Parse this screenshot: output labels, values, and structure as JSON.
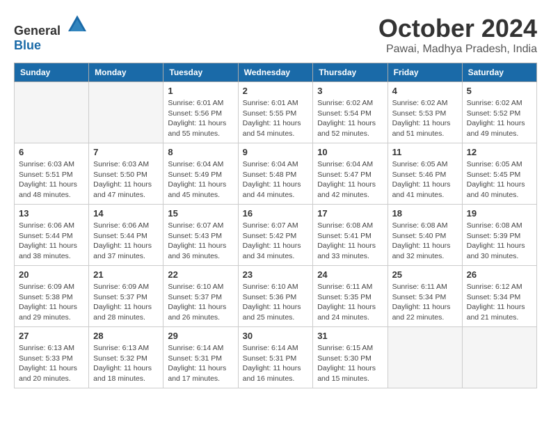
{
  "header": {
    "logo_general": "General",
    "logo_blue": "Blue",
    "month_title": "October 2024",
    "location": "Pawai, Madhya Pradesh, India"
  },
  "weekdays": [
    "Sunday",
    "Monday",
    "Tuesday",
    "Wednesday",
    "Thursday",
    "Friday",
    "Saturday"
  ],
  "weeks": [
    [
      {
        "day": null,
        "info": null
      },
      {
        "day": null,
        "info": null
      },
      {
        "day": "1",
        "info": "Sunrise: 6:01 AM\nSunset: 5:56 PM\nDaylight: 11 hours and 55 minutes."
      },
      {
        "day": "2",
        "info": "Sunrise: 6:01 AM\nSunset: 5:55 PM\nDaylight: 11 hours and 54 minutes."
      },
      {
        "day": "3",
        "info": "Sunrise: 6:02 AM\nSunset: 5:54 PM\nDaylight: 11 hours and 52 minutes."
      },
      {
        "day": "4",
        "info": "Sunrise: 6:02 AM\nSunset: 5:53 PM\nDaylight: 11 hours and 51 minutes."
      },
      {
        "day": "5",
        "info": "Sunrise: 6:02 AM\nSunset: 5:52 PM\nDaylight: 11 hours and 49 minutes."
      }
    ],
    [
      {
        "day": "6",
        "info": "Sunrise: 6:03 AM\nSunset: 5:51 PM\nDaylight: 11 hours and 48 minutes."
      },
      {
        "day": "7",
        "info": "Sunrise: 6:03 AM\nSunset: 5:50 PM\nDaylight: 11 hours and 47 minutes."
      },
      {
        "day": "8",
        "info": "Sunrise: 6:04 AM\nSunset: 5:49 PM\nDaylight: 11 hours and 45 minutes."
      },
      {
        "day": "9",
        "info": "Sunrise: 6:04 AM\nSunset: 5:48 PM\nDaylight: 11 hours and 44 minutes."
      },
      {
        "day": "10",
        "info": "Sunrise: 6:04 AM\nSunset: 5:47 PM\nDaylight: 11 hours and 42 minutes."
      },
      {
        "day": "11",
        "info": "Sunrise: 6:05 AM\nSunset: 5:46 PM\nDaylight: 11 hours and 41 minutes."
      },
      {
        "day": "12",
        "info": "Sunrise: 6:05 AM\nSunset: 5:45 PM\nDaylight: 11 hours and 40 minutes."
      }
    ],
    [
      {
        "day": "13",
        "info": "Sunrise: 6:06 AM\nSunset: 5:44 PM\nDaylight: 11 hours and 38 minutes."
      },
      {
        "day": "14",
        "info": "Sunrise: 6:06 AM\nSunset: 5:44 PM\nDaylight: 11 hours and 37 minutes."
      },
      {
        "day": "15",
        "info": "Sunrise: 6:07 AM\nSunset: 5:43 PM\nDaylight: 11 hours and 36 minutes."
      },
      {
        "day": "16",
        "info": "Sunrise: 6:07 AM\nSunset: 5:42 PM\nDaylight: 11 hours and 34 minutes."
      },
      {
        "day": "17",
        "info": "Sunrise: 6:08 AM\nSunset: 5:41 PM\nDaylight: 11 hours and 33 minutes."
      },
      {
        "day": "18",
        "info": "Sunrise: 6:08 AM\nSunset: 5:40 PM\nDaylight: 11 hours and 32 minutes."
      },
      {
        "day": "19",
        "info": "Sunrise: 6:08 AM\nSunset: 5:39 PM\nDaylight: 11 hours and 30 minutes."
      }
    ],
    [
      {
        "day": "20",
        "info": "Sunrise: 6:09 AM\nSunset: 5:38 PM\nDaylight: 11 hours and 29 minutes."
      },
      {
        "day": "21",
        "info": "Sunrise: 6:09 AM\nSunset: 5:37 PM\nDaylight: 11 hours and 28 minutes."
      },
      {
        "day": "22",
        "info": "Sunrise: 6:10 AM\nSunset: 5:37 PM\nDaylight: 11 hours and 26 minutes."
      },
      {
        "day": "23",
        "info": "Sunrise: 6:10 AM\nSunset: 5:36 PM\nDaylight: 11 hours and 25 minutes."
      },
      {
        "day": "24",
        "info": "Sunrise: 6:11 AM\nSunset: 5:35 PM\nDaylight: 11 hours and 24 minutes."
      },
      {
        "day": "25",
        "info": "Sunrise: 6:11 AM\nSunset: 5:34 PM\nDaylight: 11 hours and 22 minutes."
      },
      {
        "day": "26",
        "info": "Sunrise: 6:12 AM\nSunset: 5:34 PM\nDaylight: 11 hours and 21 minutes."
      }
    ],
    [
      {
        "day": "27",
        "info": "Sunrise: 6:13 AM\nSunset: 5:33 PM\nDaylight: 11 hours and 20 minutes."
      },
      {
        "day": "28",
        "info": "Sunrise: 6:13 AM\nSunset: 5:32 PM\nDaylight: 11 hours and 18 minutes."
      },
      {
        "day": "29",
        "info": "Sunrise: 6:14 AM\nSunset: 5:31 PM\nDaylight: 11 hours and 17 minutes."
      },
      {
        "day": "30",
        "info": "Sunrise: 6:14 AM\nSunset: 5:31 PM\nDaylight: 11 hours and 16 minutes."
      },
      {
        "day": "31",
        "info": "Sunrise: 6:15 AM\nSunset: 5:30 PM\nDaylight: 11 hours and 15 minutes."
      },
      {
        "day": null,
        "info": null
      },
      {
        "day": null,
        "info": null
      }
    ]
  ]
}
